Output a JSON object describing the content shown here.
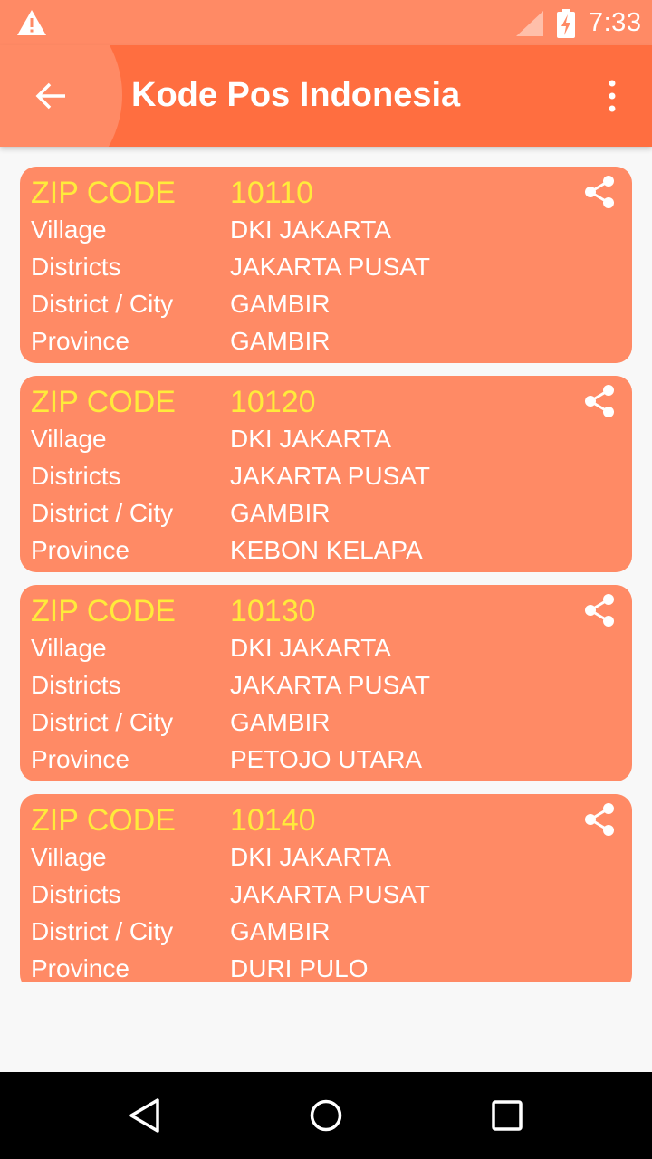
{
  "status_bar": {
    "time": "7:33",
    "icons": [
      "warning-icon",
      "signal-icon",
      "battery-charging-icon"
    ]
  },
  "app_bar": {
    "title": "Kode Pos Indonesia",
    "back_icon": "arrow-left-icon",
    "menu_icon": "more-vert-icon"
  },
  "colors": {
    "app_bar": "#ff6e40",
    "status_bar": "#ff8a65",
    "card": "#ff8a65",
    "zip_text": "#ffeb3b",
    "text": "#ffffff"
  },
  "labels": {
    "zip": "ZIP CODE",
    "village": "Village",
    "districts": "Districts",
    "city": "District / City",
    "province": "Province"
  },
  "cards": [
    {
      "zip": "10110",
      "village": "DKI JAKARTA",
      "districts": "JAKARTA PUSAT",
      "city": "GAMBIR",
      "province": "GAMBIR"
    },
    {
      "zip": "10120",
      "village": "DKI JAKARTA",
      "districts": "JAKARTA PUSAT",
      "city": "GAMBIR",
      "province": "KEBON KELAPA"
    },
    {
      "zip": "10130",
      "village": "DKI JAKARTA",
      "districts": "JAKARTA PUSAT",
      "city": "GAMBIR",
      "province": "PETOJO UTARA"
    },
    {
      "zip": "10140",
      "village": "DKI JAKARTA",
      "districts": "JAKARTA PUSAT",
      "city": "GAMBIR",
      "province": "DURI PULO"
    }
  ],
  "nav_bar": {
    "icons": [
      "nav-back-icon",
      "nav-home-icon",
      "nav-recents-icon"
    ]
  }
}
